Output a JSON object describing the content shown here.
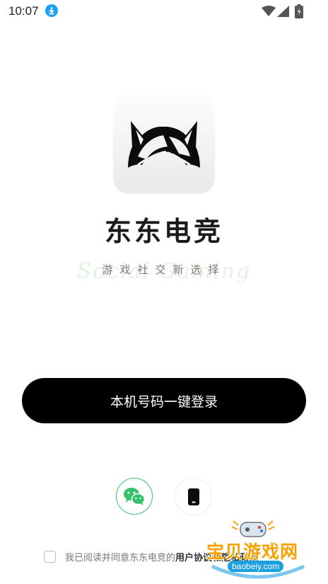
{
  "status_bar": {
    "time": "10:07"
  },
  "app": {
    "name": "东东电竞",
    "slogan": "游戏社交新选择",
    "slogan_watermark": "Social Gaming"
  },
  "login": {
    "one_click_label": "本机号码一键登录"
  },
  "alt_login": {
    "wechat_icon": "wechat-icon",
    "phone_icon": "phone-icon"
  },
  "agreement": {
    "text": "我已阅读并同意东东电竞的",
    "link": "用户协议和隐私政策"
  },
  "watermark": {
    "cn": "宝贝游戏网",
    "en": "baobeiy.com"
  },
  "colors": {
    "accent_green": "#36c26d",
    "button_black": "#000000",
    "download_blue": "#1da1f2",
    "watermark_orange": "#f5a200"
  }
}
